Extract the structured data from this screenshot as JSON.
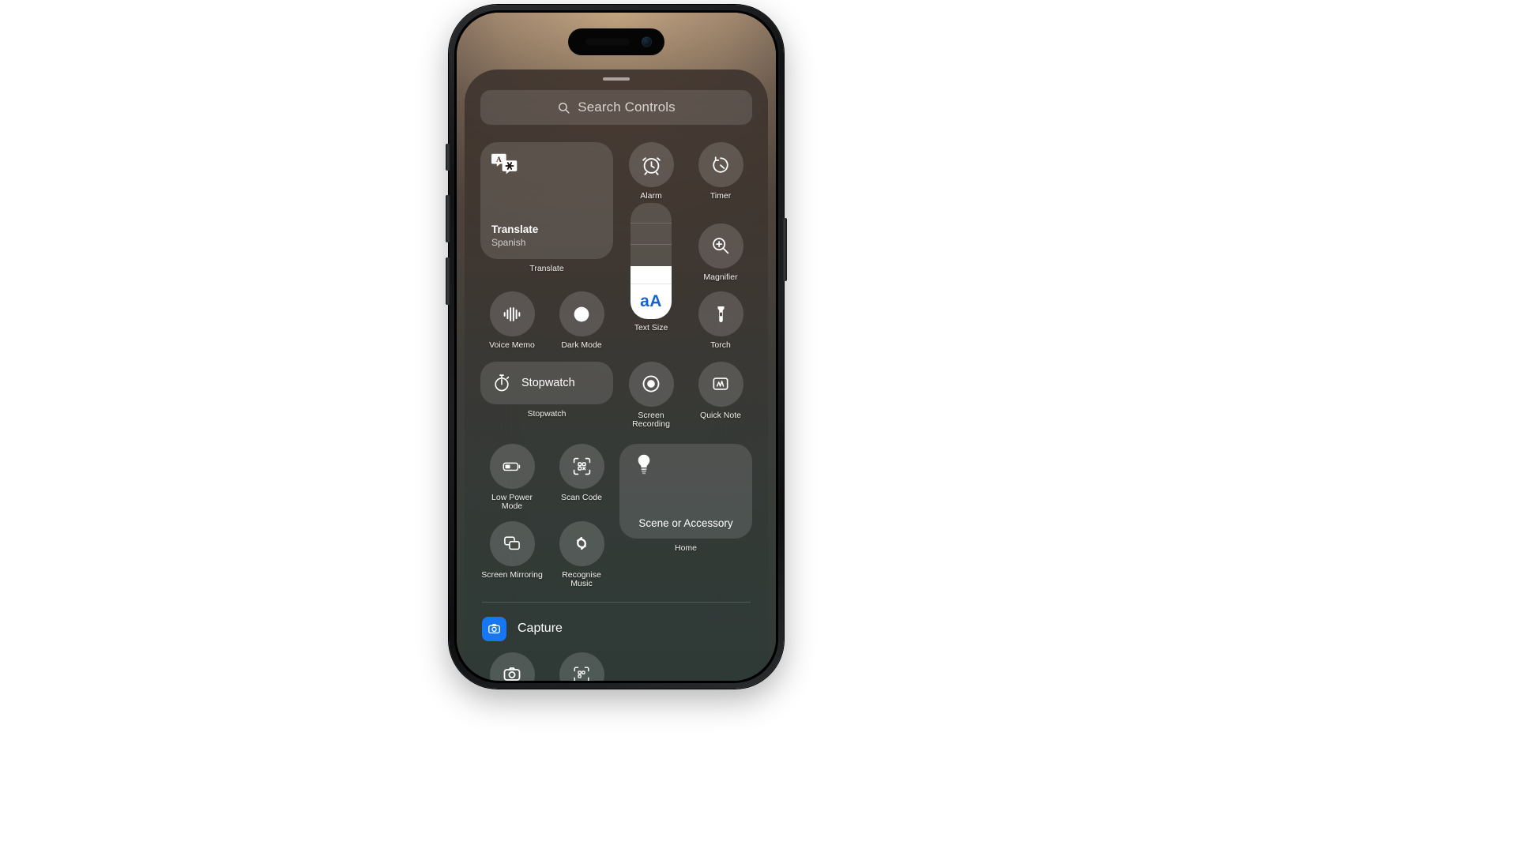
{
  "device": {
    "name": "iPhone",
    "screen_state": "Control Center open"
  },
  "search": {
    "placeholder": "Search Controls"
  },
  "controls": {
    "translate": {
      "title": "Translate",
      "subtitle": "Spanish",
      "caption": "Translate",
      "icon": "translate-icon",
      "tile_size": "2x2"
    },
    "alarm": {
      "label": "Alarm",
      "icon": "alarm-icon"
    },
    "timer": {
      "label": "Timer",
      "icon": "timer-icon"
    },
    "magnifier": {
      "label": "Magnifier",
      "icon": "magnifier-icon"
    },
    "text_size": {
      "label": "Text Size",
      "glyph": "aA",
      "icon": "text-size-slider",
      "accent_color": "#1463d2",
      "fill_percent": 46
    },
    "voice_memo": {
      "label": "Voice Memo",
      "icon": "voice-memo-icon"
    },
    "dark_mode": {
      "label": "Dark Mode",
      "icon": "dark-mode-icon"
    },
    "torch": {
      "label": "Torch",
      "icon": "torch-icon"
    },
    "stopwatch": {
      "label": "Stopwatch",
      "caption": "Stopwatch",
      "icon": "stopwatch-icon",
      "tile_size": "2x1"
    },
    "screen_recording": {
      "label": "Screen Recording",
      "icon": "screen-recording-icon"
    },
    "quick_note": {
      "label": "Quick Note",
      "icon": "quick-note-icon"
    },
    "low_power_mode": {
      "label": "Low Power Mode",
      "icon": "low-power-mode-icon"
    },
    "scan_code": {
      "label": "Scan Code",
      "icon": "scan-code-icon"
    },
    "home": {
      "tile_label": "Scene or Accessory",
      "caption": "Home",
      "icon": "lightbulb-icon",
      "tile_size": "2x2"
    },
    "screen_mirroring": {
      "label": "Screen Mirroring",
      "icon": "screen-mirroring-icon"
    },
    "recognise_music": {
      "label": "Recognise Music",
      "icon": "shazam-icon"
    }
  },
  "capture": {
    "label": "Capture",
    "icon": "camera-icon",
    "chip_color": "#1777f2"
  },
  "colors": {
    "accent_blue": "#1777f2",
    "text_size_blue": "#1463d2",
    "control_fill": "rgba(255,255,255,0.15)",
    "sheet_background": "rgba(58,52,47,0.86)",
    "label_text": "#f2efec"
  }
}
